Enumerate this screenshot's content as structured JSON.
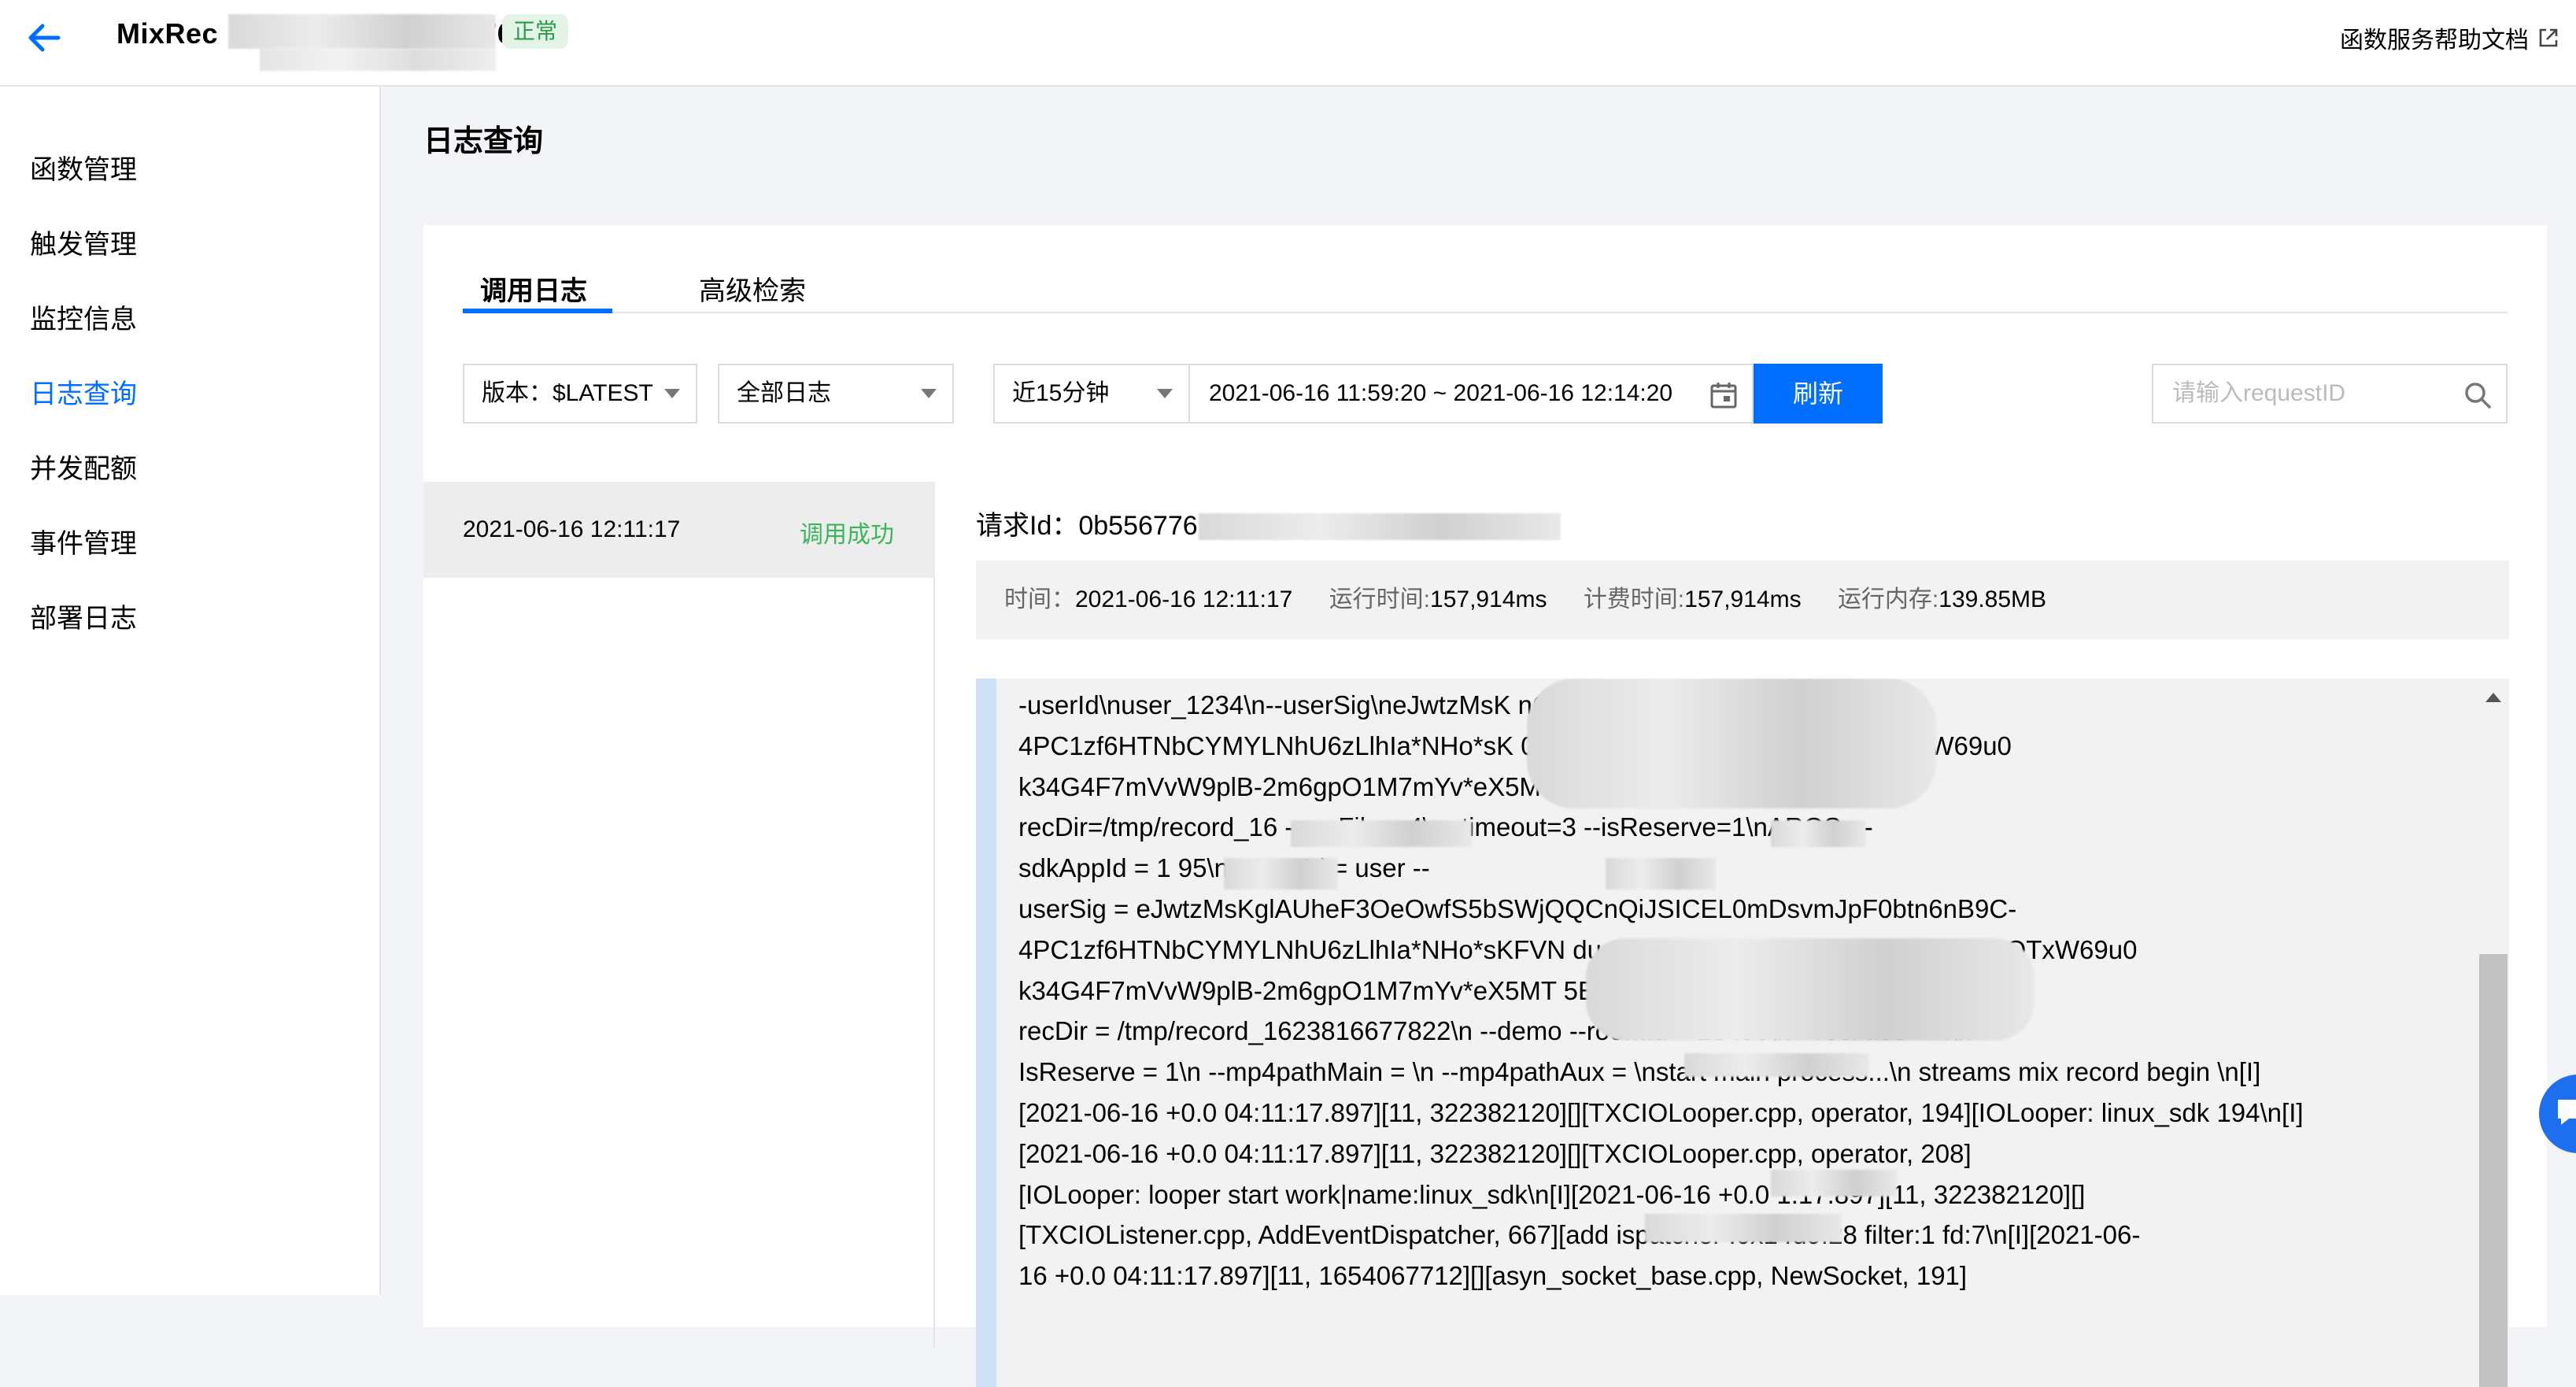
{
  "header": {
    "title_prefix": "MixRec",
    "title_suffix": "1623317776",
    "status": "正常",
    "help_link": "函数服务帮助文档"
  },
  "sidebar": {
    "items": [
      {
        "label": "函数管理"
      },
      {
        "label": "触发管理"
      },
      {
        "label": "监控信息"
      },
      {
        "label": "日志查询"
      },
      {
        "label": "并发配额"
      },
      {
        "label": "事件管理"
      },
      {
        "label": "部署日志"
      }
    ],
    "active": "日志查询"
  },
  "main": {
    "page_title": "日志查询",
    "tabs": [
      {
        "label": "调用日志"
      },
      {
        "label": "高级检索"
      }
    ],
    "filters": {
      "version": "版本：$LATEST",
      "log_type": "全部日志",
      "time_span": "近15分钟",
      "date_range": "2021-06-16 11:59:20 ~ 2021-06-16 12:14:20",
      "refresh_label": "刷新",
      "search_placeholder": "请输入requestID"
    },
    "log_list": [
      {
        "time": "2021-06-16 12:11:17",
        "status": "调用成功"
      }
    ],
    "detail": {
      "request_label": "请求Id：",
      "request_id": "0b556776",
      "time_label": "时间：",
      "time": "2021-06-16 12:11:17",
      "run_time_label": "运行时间:",
      "run_time": "157,914ms",
      "billed_time_label": "计费时间:",
      "billed_time": "157,914ms",
      "memory_label": "运行内存:",
      "memory": "139.85MB",
      "log_lines": [
        "-userId\\nuser_1234\\n--userSig\\neJwtzMsK                                      nQiJSICEL0mDsvmJpF0btn6nB9C-",
        "4PC1zf6HTNbCYMYLNhU6zLlhIa*NHo*sK                                              0q6Ja946IAgBGban4mykkVwqQTxW69u0",
        "k34G4F7mVvW9plB-2m6gpO1M7mYv*eX5M                                         tM_\\n--",
        "recDir=/tmp/record_16              --recFiles=4\\n--timeout=3           --isReserve=1\\nARGS:   --",
        "sdkAppId = 1           95\\n        --userId = user               --",
        "userSig = eJwtzMsKglAUheF3OeOwfS5bSWjQQCnQiJSICEL0mDsvmJpF0btn6nB9C-",
        "4PC1zf6HTNbCYMYLNhU6zLlhIa*NHo*sKFVN                              ducHz0q6Ja946IAgBGban4mykkVwqQTxW69u0",
        "k34G4F7mVvW9plB-2m6gpO1M7mYv*eX5MT                               5EMtM_\\n        --",
        "recDir = /tmp/record_1623816677822\\n        --demo                        --roomId = 23456\\n        --recFiles = 4\\n        --",
        "IsReserve = 1\\n        --mp4pathMain = \\n        --mp4pathAux = \\nstart main process...\\n streams mix record begin \\n[I]",
        "[2021-06-16 +0.0 04:11:17.897][11, 322382120][][TXCIOLooper.cpp, operator, 194][IOLooper: linux_sdk 194\\n[I]",
        "[2021-06-16 +0.0 04:11:17.897][11, 322382120][][TXCIOLooper.cpp, operator, 208]",
        "[IOLooper: looper start work|name:linux_sdk\\n[I][2021-06-16 +0.0    1:17.897][11, 322382120][]",
        "[TXCIOListener.cpp, AddEventDispatcher, 667][add         ispatcher :0x14d9f28 filter:1 fd:7\\n[I][2021-06-",
        "16 +0.0 04:11:17.897][11, 1654067712][][asyn_socket_base.cpp, NewSocket, 191]"
      ]
    }
  },
  "colors": {
    "accent": "#006eff",
    "success": "#3cb65a",
    "badge_bg": "#e3f4e6",
    "badge_text": "#2b9a4a"
  },
  "icons": [
    "back-arrow-icon",
    "external-link-icon",
    "caret-down-icon",
    "calendar-icon",
    "search-icon",
    "chat-icon"
  ]
}
